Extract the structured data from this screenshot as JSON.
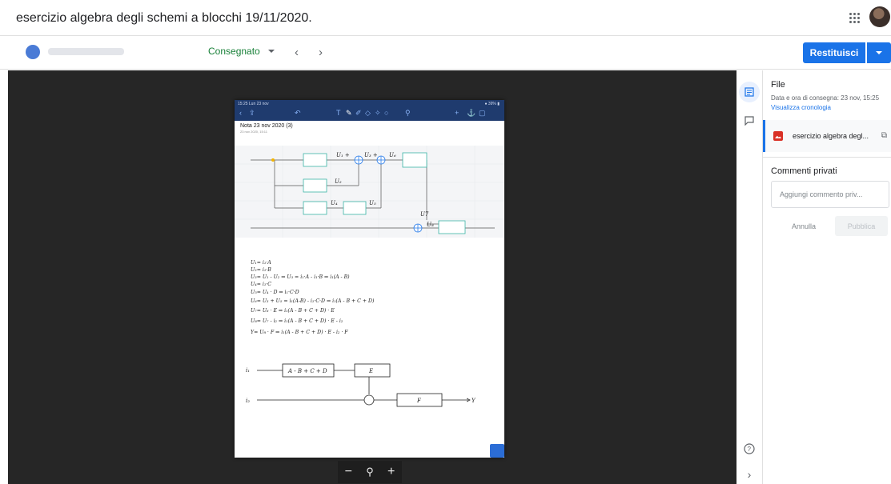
{
  "header": {
    "title": "esercizio algebra degli schemi a blocchi 19/11/2020."
  },
  "toolbar": {
    "status": "Consegnato",
    "prev": "‹",
    "next": "›",
    "return_label": "Restituisci"
  },
  "viewer": {
    "note_status_time": "15:25  Lun 23 nov",
    "note_battery": "● 39% ▮",
    "note_title": "Nota 23 nov 2020 (3)",
    "note_date": "23 nov 2020, 15:11",
    "zoom_out": "−",
    "zoom_in": "+",
    "handwriting": [
      "U₁= i₁·A",
      "U₂= i₁·B",
      "U₃= U₁ - U₂ ⇒ U₃ = i₁·A - i₁·B ⇒ i₁(A - B)",
      "U₄= i₁·C",
      "U₅= U₄ · D ⇒ i₁·C·D",
      "U₆= U₃ + U₅ = i₁(A-B) - i₁·C·D ⇒ i₁(A - B + C + D)",
      "U₇= U₆ · E ⇒ i₁(A - B + C + D) · E",
      "U₈= U₇ - i₂ ⇒ i₁(A - B + C + D) · E - i₂",
      "Y= U₈ · F ⇒ i₁(A - B + C + D) · E - i₂ · F"
    ],
    "diagram_labels": {
      "u1": "U₁ +",
      "u3": "U₃ +",
      "u6": "U₆",
      "u2": "U₂",
      "u4": "U₄",
      "u5": "U₅",
      "u7": "U7",
      "u8": "U₈",
      "i1": "i₁",
      "i2": "i₂",
      "block1": "A - B + C + D",
      "blockE": "E",
      "blockF": "F",
      "out": "Y"
    }
  },
  "panel": {
    "file_heading": "File",
    "delivery": "Data e ora di consegna: 23 nov, 15:25",
    "history_link": "Visualizza cronologia",
    "file_name": "esercizio algebra degl...",
    "comments_heading": "Commenti privati",
    "comment_placeholder": "Aggiungi commento priv...",
    "cancel": "Annulla",
    "publish": "Pubblica"
  },
  "colors": {
    "accent": "#1a73e8",
    "status_green": "#188038",
    "viewer_bg": "#262626"
  }
}
